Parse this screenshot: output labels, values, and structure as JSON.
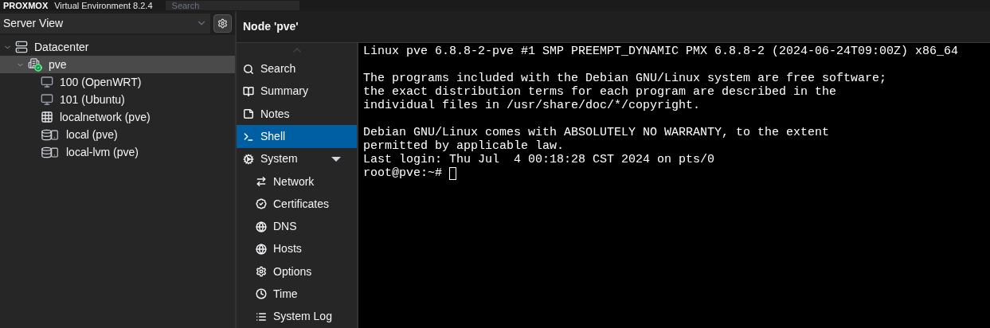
{
  "header": {
    "logo": "PROXMOX",
    "subtitle": "Virtual Environment 8.2.4",
    "search": {
      "placeholder": "Search"
    }
  },
  "view_selector": {
    "value": "Server View"
  },
  "tree": [
    {
      "label": "Datacenter",
      "kind": "datacenter",
      "selected": false,
      "expanded": true,
      "children": [
        {
          "label": "pve",
          "kind": "node",
          "selected": true,
          "expanded": true,
          "children": [
            {
              "label": "100 (OpenWRT)",
              "kind": "vm",
              "selected": false
            },
            {
              "label": "101 (Ubuntu)",
              "kind": "vm",
              "selected": false
            },
            {
              "label": "localnetwork (pve)",
              "kind": "network",
              "selected": false
            },
            {
              "label": "local (pve)",
              "kind": "storage",
              "selected": false
            },
            {
              "label": "local-lvm (pve)",
              "kind": "storage",
              "selected": false
            }
          ]
        }
      ]
    }
  ],
  "panel_title": "Node 'pve'",
  "menu": [
    {
      "label": "Search",
      "kind": "search",
      "selected": false
    },
    {
      "label": "Summary",
      "kind": "book",
      "selected": false
    },
    {
      "label": "Notes",
      "kind": "note",
      "selected": false
    },
    {
      "label": "Shell",
      "kind": "terminal",
      "selected": true
    },
    {
      "label": "System",
      "kind": "cogs",
      "selected": false,
      "expanded": true,
      "children": [
        {
          "label": "Network",
          "kind": "arrows",
          "selected": false
        },
        {
          "label": "Certificates",
          "kind": "cert",
          "selected": false
        },
        {
          "label": "DNS",
          "kind": "globe",
          "selected": false
        },
        {
          "label": "Hosts",
          "kind": "globe",
          "selected": false
        },
        {
          "label": "Options",
          "kind": "gear",
          "selected": false
        },
        {
          "label": "Time",
          "kind": "clock",
          "selected": false
        },
        {
          "label": "System Log",
          "kind": "list",
          "selected": false
        }
      ]
    }
  ],
  "terminal": {
    "paragraphs": [
      [
        "Linux pve 6.8.8-2-pve #1 SMP PREEMPT_DYNAMIC PMX 6.8.8-2 (2024-06-24T09:00Z) x86_64"
      ],
      [
        "The programs included with the Debian GNU/Linux system are free software;",
        "the exact distribution terms for each program are described in the",
        "individual files in /usr/share/doc/*/copyright."
      ],
      [
        "Debian GNU/Linux comes with ABSOLUTELY NO WARRANTY, to the extent",
        "permitted by applicable law.",
        "Last login: Thu Jul  4 00:18:28 CST 2024 on pts/0"
      ]
    ],
    "prompt": "root@pve:~#"
  }
}
